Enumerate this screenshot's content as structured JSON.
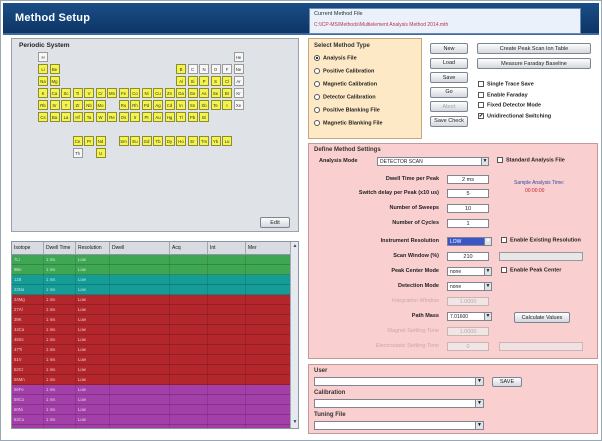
{
  "window": {
    "title": "Method Setup",
    "current_file_label": "Current Method File",
    "current_file_path": "C:\\ICP-MS\\Methods\\Multielement Analysis Method 2014.mth"
  },
  "periodic": {
    "title": "Periodic System",
    "edit_label": "Edit",
    "elements": [
      {
        "s": "H",
        "r": 0,
        "c": 0,
        "on": false
      },
      {
        "s": "He",
        "r": 0,
        "c": 17,
        "on": false
      },
      {
        "s": "Li",
        "r": 1,
        "c": 0,
        "on": true
      },
      {
        "s": "Be",
        "r": 1,
        "c": 1,
        "on": true
      },
      {
        "s": "B",
        "r": 1,
        "c": 12,
        "on": true
      },
      {
        "s": "C",
        "r": 1,
        "c": 13,
        "on": false
      },
      {
        "s": "N",
        "r": 1,
        "c": 14,
        "on": false
      },
      {
        "s": "O",
        "r": 1,
        "c": 15,
        "on": false
      },
      {
        "s": "F",
        "r": 1,
        "c": 16,
        "on": false
      },
      {
        "s": "Ne",
        "r": 1,
        "c": 17,
        "on": false
      },
      {
        "s": "Na",
        "r": 2,
        "c": 0,
        "on": true
      },
      {
        "s": "Mg",
        "r": 2,
        "c": 1,
        "on": true
      },
      {
        "s": "Al",
        "r": 2,
        "c": 12,
        "on": true
      },
      {
        "s": "Si",
        "r": 2,
        "c": 13,
        "on": true
      },
      {
        "s": "P",
        "r": 2,
        "c": 14,
        "on": true
      },
      {
        "s": "S",
        "r": 2,
        "c": 15,
        "on": true
      },
      {
        "s": "Cl",
        "r": 2,
        "c": 16,
        "on": true
      },
      {
        "s": "Ar",
        "r": 2,
        "c": 17,
        "on": false
      },
      {
        "s": "K",
        "r": 3,
        "c": 0,
        "on": true
      },
      {
        "s": "Ca",
        "r": 3,
        "c": 1,
        "on": true
      },
      {
        "s": "Sc",
        "r": 3,
        "c": 2,
        "on": true
      },
      {
        "s": "Ti",
        "r": 3,
        "c": 3,
        "on": true
      },
      {
        "s": "V",
        "r": 3,
        "c": 4,
        "on": true
      },
      {
        "s": "Cr",
        "r": 3,
        "c": 5,
        "on": true
      },
      {
        "s": "Mn",
        "r": 3,
        "c": 6,
        "on": true
      },
      {
        "s": "Fe",
        "r": 3,
        "c": 7,
        "on": true
      },
      {
        "s": "Co",
        "r": 3,
        "c": 8,
        "on": true
      },
      {
        "s": "Ni",
        "r": 3,
        "c": 9,
        "on": true
      },
      {
        "s": "Cu",
        "r": 3,
        "c": 10,
        "on": true
      },
      {
        "s": "Zn",
        "r": 3,
        "c": 11,
        "on": true
      },
      {
        "s": "Ga",
        "r": 3,
        "c": 12,
        "on": true
      },
      {
        "s": "Ge",
        "r": 3,
        "c": 13,
        "on": true
      },
      {
        "s": "As",
        "r": 3,
        "c": 14,
        "on": true
      },
      {
        "s": "Se",
        "r": 3,
        "c": 15,
        "on": true
      },
      {
        "s": "Br",
        "r": 3,
        "c": 16,
        "on": true
      },
      {
        "s": "Kr",
        "r": 3,
        "c": 17,
        "on": false
      },
      {
        "s": "Rb",
        "r": 4,
        "c": 0,
        "on": true
      },
      {
        "s": "Sr",
        "r": 4,
        "c": 1,
        "on": true
      },
      {
        "s": "Y",
        "r": 4,
        "c": 2,
        "on": true
      },
      {
        "s": "Zr",
        "r": 4,
        "c": 3,
        "on": true
      },
      {
        "s": "Nb",
        "r": 4,
        "c": 4,
        "on": true
      },
      {
        "s": "Mo",
        "r": 4,
        "c": 5,
        "on": true
      },
      {
        "s": "Ru",
        "r": 4,
        "c": 7,
        "on": true
      },
      {
        "s": "Rh",
        "r": 4,
        "c": 8,
        "on": true
      },
      {
        "s": "Pd",
        "r": 4,
        "c": 9,
        "on": true
      },
      {
        "s": "Ag",
        "r": 4,
        "c": 10,
        "on": true
      },
      {
        "s": "Cd",
        "r": 4,
        "c": 11,
        "on": true
      },
      {
        "s": "In",
        "r": 4,
        "c": 12,
        "on": true
      },
      {
        "s": "Sn",
        "r": 4,
        "c": 13,
        "on": true
      },
      {
        "s": "Sb",
        "r": 4,
        "c": 14,
        "on": true
      },
      {
        "s": "Te",
        "r": 4,
        "c": 15,
        "on": true
      },
      {
        "s": "I",
        "r": 4,
        "c": 16,
        "on": true
      },
      {
        "s": "Xe",
        "r": 4,
        "c": 17,
        "on": false
      },
      {
        "s": "Cs",
        "r": 5,
        "c": 0,
        "on": true
      },
      {
        "s": "Ba",
        "r": 5,
        "c": 1,
        "on": true
      },
      {
        "s": "La",
        "r": 5,
        "c": 2,
        "on": true
      },
      {
        "s": "Hf",
        "r": 5,
        "c": 3,
        "on": true
      },
      {
        "s": "Ta",
        "r": 5,
        "c": 4,
        "on": true
      },
      {
        "s": "W",
        "r": 5,
        "c": 5,
        "on": true
      },
      {
        "s": "Re",
        "r": 5,
        "c": 6,
        "on": true
      },
      {
        "s": "Os",
        "r": 5,
        "c": 7,
        "on": true
      },
      {
        "s": "Ir",
        "r": 5,
        "c": 8,
        "on": true
      },
      {
        "s": "Pt",
        "r": 5,
        "c": 9,
        "on": true
      },
      {
        "s": "Au",
        "r": 5,
        "c": 10,
        "on": true
      },
      {
        "s": "Hg",
        "r": 5,
        "c": 11,
        "on": true
      },
      {
        "s": "Tl",
        "r": 5,
        "c": 12,
        "on": true
      },
      {
        "s": "Pb",
        "r": 5,
        "c": 13,
        "on": true
      },
      {
        "s": "Bi",
        "r": 5,
        "c": 14,
        "on": true
      },
      {
        "s": "Ce",
        "r": 7,
        "c": 3,
        "on": true
      },
      {
        "s": "Pr",
        "r": 7,
        "c": 4,
        "on": true
      },
      {
        "s": "Nd",
        "r": 7,
        "c": 5,
        "on": true
      },
      {
        "s": "Sm",
        "r": 7,
        "c": 7,
        "on": true
      },
      {
        "s": "Eu",
        "r": 7,
        "c": 8,
        "on": true
      },
      {
        "s": "Gd",
        "r": 7,
        "c": 9,
        "on": true
      },
      {
        "s": "Tb",
        "r": 7,
        "c": 10,
        "on": true
      },
      {
        "s": "Dy",
        "r": 7,
        "c": 11,
        "on": true
      },
      {
        "s": "Ho",
        "r": 7,
        "c": 12,
        "on": true
      },
      {
        "s": "Er",
        "r": 7,
        "c": 13,
        "on": true
      },
      {
        "s": "Tm",
        "r": 7,
        "c": 14,
        "on": true
      },
      {
        "s": "Yb",
        "r": 7,
        "c": 15,
        "on": true
      },
      {
        "s": "Lu",
        "r": 7,
        "c": 16,
        "on": true
      },
      {
        "s": "Th",
        "r": 8,
        "c": 3,
        "on": false
      },
      {
        "s": "U",
        "r": 8,
        "c": 5,
        "on": true
      }
    ]
  },
  "table": {
    "headers": [
      "Isotope",
      "Dwell Time",
      "Resolution",
      "Dwell",
      "Acq",
      "Int",
      "Mer"
    ],
    "rows": [
      {
        "color": "#3fa653",
        "cells": [
          "7Li",
          "1 ms",
          "Low",
          "",
          "",
          "",
          ""
        ]
      },
      {
        "color": "#3fa653",
        "cells": [
          "9Be",
          "1 ms",
          "Low",
          "",
          "",
          "",
          ""
        ]
      },
      {
        "color": "#159c97",
        "cells": [
          "11B",
          "1 ms",
          "Low",
          "",
          "",
          "",
          ""
        ]
      },
      {
        "color": "#159c97",
        "cells": [
          "23Na",
          "1 ms",
          "Low",
          "",
          "",
          "",
          ""
        ]
      },
      {
        "color": "#b2262c",
        "cells": [
          "24Mg",
          "1 ms",
          "Low",
          "",
          "",
          "",
          ""
        ]
      },
      {
        "color": "#b2262c",
        "cells": [
          "27Al",
          "1 ms",
          "Low",
          "",
          "",
          "",
          ""
        ]
      },
      {
        "color": "#b2262c",
        "cells": [
          "39K",
          "1 ms",
          "Low",
          "",
          "",
          "",
          ""
        ]
      },
      {
        "color": "#b2262c",
        "cells": [
          "44Ca",
          "1 ms",
          "Low",
          "",
          "",
          "",
          ""
        ]
      },
      {
        "color": "#b2262c",
        "cells": [
          "45Sc",
          "1 ms",
          "Low",
          "",
          "",
          "",
          ""
        ]
      },
      {
        "color": "#b2262c",
        "cells": [
          "47Ti",
          "1 ms",
          "Low",
          "",
          "",
          "",
          ""
        ]
      },
      {
        "color": "#b2262c",
        "cells": [
          "51V",
          "1 ms",
          "Low",
          "",
          "",
          "",
          ""
        ]
      },
      {
        "color": "#b2262c",
        "cells": [
          "52Cr",
          "1 ms",
          "Low",
          "",
          "",
          "",
          ""
        ]
      },
      {
        "color": "#b2262c",
        "cells": [
          "55Mn",
          "1 ms",
          "Low",
          "",
          "",
          "",
          ""
        ]
      },
      {
        "color": "#a23fa8",
        "cells": [
          "56Fe",
          "1 ms",
          "Low",
          "",
          "",
          "",
          ""
        ]
      },
      {
        "color": "#a23fa8",
        "cells": [
          "59Co",
          "1 ms",
          "Low",
          "",
          "",
          "",
          ""
        ]
      },
      {
        "color": "#a23fa8",
        "cells": [
          "60Ni",
          "1 ms",
          "Low",
          "",
          "",
          "",
          ""
        ]
      },
      {
        "color": "#a23fa8",
        "cells": [
          "63Cu",
          "1 ms",
          "Low",
          "",
          "",
          "",
          ""
        ]
      },
      {
        "color": "#a23fa8",
        "cells": [
          "66Zn",
          "1 ms",
          "Low",
          "",
          "",
          "",
          ""
        ]
      }
    ]
  },
  "method_type": {
    "title": "Select Method Type",
    "options": [
      "Analysis File",
      "Positive Calibration",
      "Magnetic Calibration",
      "Detector Calibration",
      "Positive Blanking File",
      "Magnetic Blanking File"
    ],
    "selected": 0
  },
  "side_buttons": [
    "New",
    "Load",
    "Save",
    "Go",
    "Abort",
    "Save Check"
  ],
  "top_buttons": {
    "create_table": "Create Peak Scan Ion Table",
    "measure_baseline": "Measure Faraday Baseline"
  },
  "options": [
    {
      "label": "Single Trace Save",
      "checked": false
    },
    {
      "label": "Enable Faraday",
      "checked": false
    },
    {
      "label": "Fixed Detector Mode",
      "checked": false
    },
    {
      "label": "Unidirectional Switching",
      "checked": true
    }
  ],
  "define": {
    "title": "Define Method Settings",
    "analysis_mode_label": "Analysis Mode",
    "analysis_mode_value": "DETECTOR SCAN",
    "standard_file_label": "Standard Analysis File",
    "note_blue": "Sample Analysis Time:",
    "note_red": "00:00:00",
    "dwell_label": "Dwell Time per Peak",
    "dwell_value": "2 ms",
    "switch_label": "Switch delay per Peak (x10 us)",
    "switch_value": "5",
    "sweeps_label": "Number of Sweeps",
    "sweeps_value": "10",
    "cycles_label": "Number of Cycles",
    "cycles_value": "1",
    "resolution_label": "Instrument Resolution",
    "resolution_value": "LOW",
    "enable_resolution_label": "Enable Existing Resolution",
    "scan_window_label": "Scan Window (%)",
    "scan_window_value": "210",
    "peak_center_label": "Peak Center Mode",
    "peak_center_value": "none",
    "enable_peak_center_label": "Enable Peak Center",
    "detection_label": "Detection Mode",
    "detection_value": "none",
    "disabled1_label": "Integration Window",
    "disabled1_value": "1.0000",
    "path_label": "Path Mass",
    "path_value": "7.01600",
    "calc_label": "Calculate Values",
    "disabled2_label": "Magnet Settling Time",
    "disabled2_value": "1.0000",
    "disabled3_label": "Electrostatic Settling Time",
    "disabled3_value": "0"
  },
  "files": {
    "user_label": "User",
    "user_button": "SAVE",
    "calibration_label": "Calibration",
    "tuning_label": "Tuning File"
  }
}
